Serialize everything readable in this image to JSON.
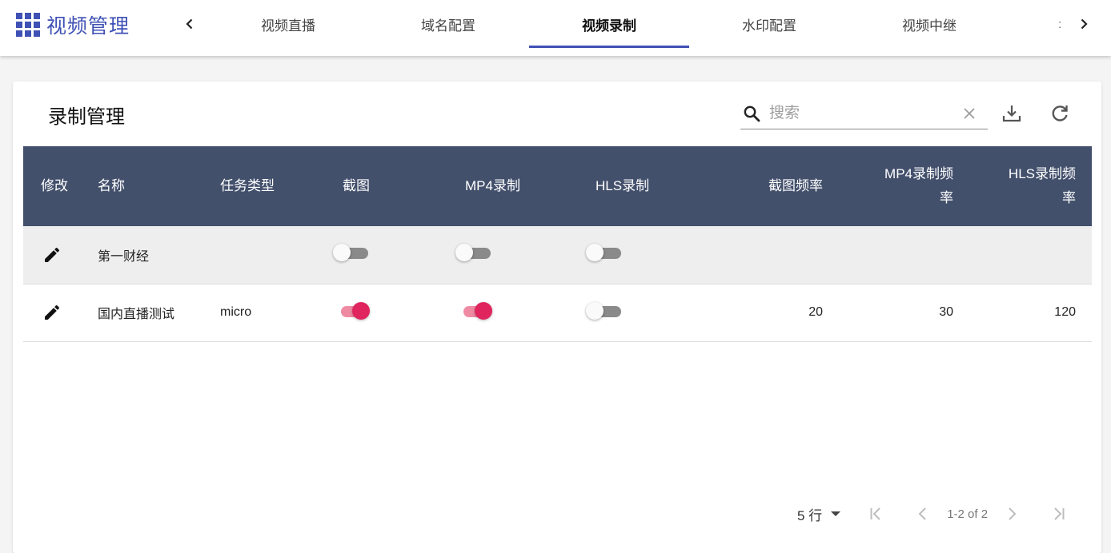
{
  "app": {
    "title": "视频管理"
  },
  "tabs": [
    {
      "label": "视频直播",
      "active": false
    },
    {
      "label": "域名配置",
      "active": false
    },
    {
      "label": "视频录制",
      "active": true
    },
    {
      "label": "水印配置",
      "active": false
    },
    {
      "label": "视频中继",
      "active": false
    }
  ],
  "tabs_overflow_glyph": ":",
  "card": {
    "title": "录制管理"
  },
  "search": {
    "placeholder": "搜索",
    "value": ""
  },
  "table": {
    "headers": {
      "edit": "修改",
      "name": "名称",
      "task_type": "任务类型",
      "snapshot": "截图",
      "mp4": "MP4录制",
      "hls": "HLS录制",
      "snapshot_rate": "截图频率",
      "mp4_rate_line1": "MP4录制频",
      "mp4_rate_line2": "率",
      "hls_rate_line1": "HLS录制频",
      "hls_rate_line2": "率"
    },
    "rows": [
      {
        "name": "第一财经",
        "task_type": "",
        "snapshot": false,
        "mp4": false,
        "hls": false,
        "snapshot_rate": "",
        "mp4_rate": "",
        "hls_rate": ""
      },
      {
        "name": "国内直播测试",
        "task_type": "micro",
        "snapshot": true,
        "mp4": true,
        "hls": false,
        "snapshot_rate": "20",
        "mp4_rate": "30",
        "hls_rate": "120"
      }
    ]
  },
  "pagination": {
    "rows_per_page": "5 行",
    "range": "1-2 of 2"
  },
  "colors": {
    "brand": "#3f51b5",
    "header_bg": "#43506c",
    "switch_on": "#e0245e"
  },
  "icons": [
    "apps-icon",
    "chevron-left-icon",
    "chevron-right-icon",
    "search-icon",
    "clear-icon",
    "download-icon",
    "refresh-icon",
    "pencil-icon",
    "dropdown-arrow-icon",
    "first-page-icon",
    "prev-page-icon",
    "next-page-icon",
    "last-page-icon"
  ]
}
